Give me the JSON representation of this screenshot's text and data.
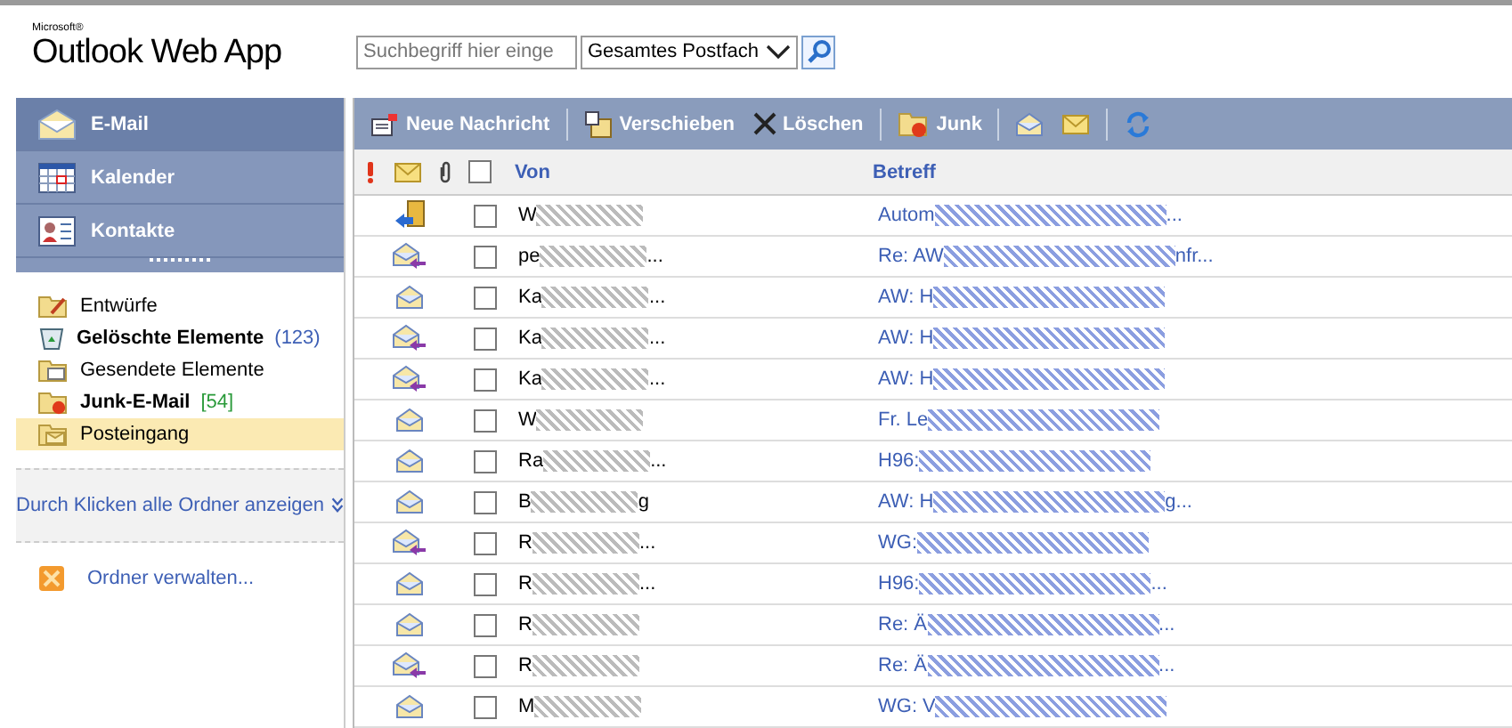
{
  "header": {
    "brand_small": "Microsoft®",
    "brand": "Outlook Web App",
    "search": {
      "placeholder": "Suchbegriff hier einge"
    },
    "scope": "Gesamtes Postfach"
  },
  "nav": [
    {
      "label": "E-Mail",
      "kind": "mail",
      "selected": true
    },
    {
      "label": "Kalender",
      "kind": "calendar",
      "selected": false
    },
    {
      "label": "Kontakte",
      "kind": "contacts",
      "selected": false
    }
  ],
  "folders": [
    {
      "label": "Entwürfe",
      "kind": "drafts",
      "bold": false,
      "selected": false
    },
    {
      "label": "Gelöschte Elemente",
      "kind": "deleted",
      "bold": true,
      "count": "(123)",
      "color": "#3d5fb5",
      "selected": false
    },
    {
      "label": "Gesendete Elemente",
      "kind": "sent",
      "bold": false,
      "selected": false
    },
    {
      "label": "Junk-E-Mail",
      "kind": "junk",
      "bold": true,
      "count": "[54]",
      "color": "#2a9a3a",
      "selected": false
    },
    {
      "label": "Posteingang",
      "kind": "inbox",
      "bold": false,
      "selected": true
    }
  ],
  "show_all_folders": "Durch Klicken alle Ordner anzeigen",
  "manage_folders": "Ordner verwalten...",
  "toolbar": [
    {
      "label": "Neue Nachricht",
      "kind": "new"
    },
    {
      "kind": "sep"
    },
    {
      "label": "Verschieben",
      "kind": "move"
    },
    {
      "label": "Löschen",
      "kind": "delete"
    },
    {
      "kind": "sep"
    },
    {
      "label": "Junk",
      "kind": "junk"
    },
    {
      "kind": "sep"
    },
    {
      "kind": "read"
    },
    {
      "kind": "unread"
    },
    {
      "kind": "sep"
    },
    {
      "kind": "refresh"
    }
  ],
  "columns": {
    "from": "Von",
    "subject": "Betreff",
    "all_checked": false
  },
  "rows": [
    {
      "kind": "meeting",
      "from": "W",
      "from_tail": "",
      "subject": "Autom",
      "subject_tail": "...",
      "checked": false
    },
    {
      "kind": "replied",
      "from": "pe",
      "from_tail": "...",
      "subject": "Re: AW",
      "subject_tail": "nfr...",
      "checked": false
    },
    {
      "kind": "read",
      "from": "Ka",
      "from_tail": "...",
      "subject": "AW: H",
      "subject_tail": "",
      "checked": false
    },
    {
      "kind": "replied",
      "from": "Ka",
      "from_tail": "...",
      "subject": "AW: H",
      "subject_tail": "",
      "checked": false
    },
    {
      "kind": "replied",
      "from": "Ka",
      "from_tail": "...",
      "subject": "AW: H",
      "subject_tail": "",
      "checked": false
    },
    {
      "kind": "read",
      "from": "W",
      "from_tail": "",
      "subject": "Fr. Le",
      "subject_tail": "",
      "checked": false
    },
    {
      "kind": "read",
      "from": "Ra",
      "from_tail": "...",
      "subject": "H96:",
      "subject_tail": "",
      "checked": false
    },
    {
      "kind": "read",
      "from": "B",
      "from_tail": "g",
      "subject": "AW: H",
      "subject_tail": "g...",
      "checked": false
    },
    {
      "kind": "replied",
      "from": "R",
      "from_tail": "...",
      "subject": "WG:",
      "subject_tail": "",
      "checked": false
    },
    {
      "kind": "read",
      "from": "R",
      "from_tail": "...",
      "subject": "H96:",
      "subject_tail": "...",
      "checked": false
    },
    {
      "kind": "read",
      "from": "R",
      "from_tail": "",
      "subject": "Re: Ä",
      "subject_tail": "...",
      "checked": false
    },
    {
      "kind": "replied",
      "from": "R",
      "from_tail": "",
      "subject": "Re: Ä",
      "subject_tail": "...",
      "checked": false
    },
    {
      "kind": "read",
      "from": "M",
      "from_tail": "",
      "subject": "WG: V",
      "subject_tail": "",
      "checked": false
    }
  ]
}
